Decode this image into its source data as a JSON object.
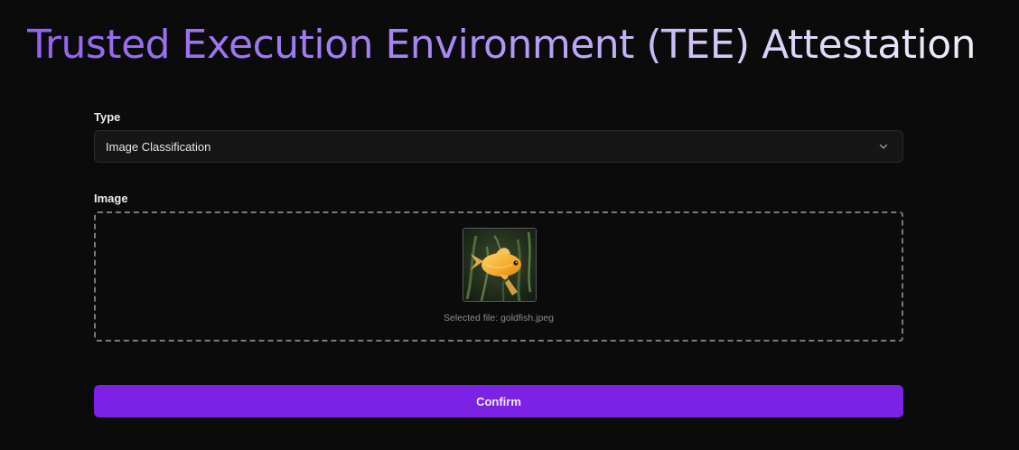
{
  "page": {
    "title": "Trusted Execution Environment (TEE) Attestation"
  },
  "form": {
    "type": {
      "label": "Type",
      "selected_value": "Image Classification",
      "icon": "chevron-down-icon"
    },
    "image": {
      "label": "Image",
      "selected_file_text": "Selected file: goldfish.jpeg",
      "thumbnail_subject": "goldfish"
    },
    "confirm_label": "Confirm"
  },
  "colors": {
    "background": "#0b0b0c",
    "accent": "#7b22e4",
    "title_gradient_start": "#9463f0",
    "title_gradient_end": "#f1eefb"
  }
}
